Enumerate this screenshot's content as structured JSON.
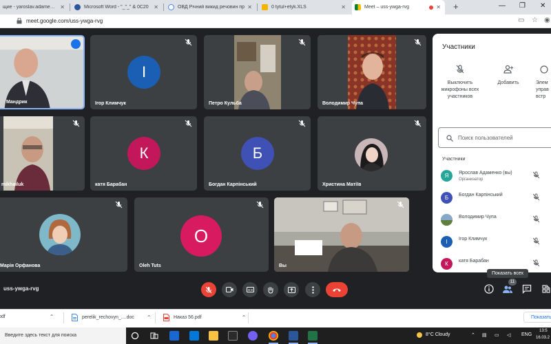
{
  "browser": {
    "tabs": [
      {
        "label": "щие - yaroslav.adamenko@",
        "active": false
      },
      {
        "label": "Microsoft Word - \"_\"_\" & 0С20",
        "active": false
      },
      {
        "label": "ОВД Річний викид речовин пр",
        "active": false
      },
      {
        "label": "0 tytul+etyk.XLS",
        "active": false
      },
      {
        "label": "Meet – uss-ywga-rvg",
        "active": true
      }
    ],
    "new_tab": "+",
    "url": "meet.google.com/uss-ywga-rvg"
  },
  "meet": {
    "tiles": [
      {
        "name": "Мандрик",
        "type": "video",
        "speaking": true
      },
      {
        "name": "Ігор Климчук",
        "type": "avatar",
        "letter": "І",
        "color": "#1a5fb4"
      },
      {
        "name": "Петро Кульба",
        "type": "video"
      },
      {
        "name": "Володимир Чупа",
        "type": "video"
      },
      {
        "name": "mikhailuk",
        "type": "video"
      },
      {
        "name": "катя Барабан",
        "type": "avatar",
        "letter": "К",
        "color": "#c2185b"
      },
      {
        "name": "Богдан Карпінський",
        "type": "avatar",
        "letter": "Б",
        "color": "#3f51b5"
      },
      {
        "name": "Христина Матіїв",
        "type": "photo"
      },
      {
        "name": "Марія Орфанова",
        "type": "photo"
      },
      {
        "name": "Oleh Tuts",
        "type": "avatar",
        "letter": "O",
        "color": "#d81b60"
      },
      {
        "name": "Вы",
        "type": "video"
      }
    ],
    "meeting_code": "uss-ywga-rvg",
    "tooltip": "Показать всех",
    "participant_count": "11"
  },
  "panel": {
    "title": "Участники",
    "actions": [
      {
        "label": "Выключить микрофоны всех участников"
      },
      {
        "label": "Добавить"
      },
      {
        "label": "Элем управ встр"
      }
    ],
    "search_placeholder": "Поиск пользователей",
    "section_label": "Участники",
    "participants": [
      {
        "name": "Ярослав Адаменко (вы)",
        "role": "Организатор",
        "letter": "Я",
        "color": "#26a69a"
      },
      {
        "name": "Богдан Карпінський",
        "role": "",
        "letter": "Б",
        "color": "#3f51b5"
      },
      {
        "name": "Володимир Чупа",
        "role": "",
        "letter": "",
        "color": "#6d8a4f"
      },
      {
        "name": "Ігор Климчук",
        "role": "",
        "letter": "І",
        "color": "#1a5fb4"
      },
      {
        "name": "катя Барабан",
        "role": "",
        "letter": "К",
        "color": "#c2185b"
      }
    ]
  },
  "downloads": {
    "items": [
      {
        "name": "pdf",
        "type": "pdf"
      },
      {
        "name": "perelik_rechovyn_....doc",
        "type": "doc"
      },
      {
        "name": "Наказ 56.pdf",
        "type": "pdf"
      }
    ],
    "show_all": "Показать"
  },
  "taskbar": {
    "search_placeholder": "Введите здесь текст для поиска",
    "weather": "8°C  Cloudy",
    "lang": "ENG",
    "time": "13:5",
    "date": "16.03.2"
  }
}
